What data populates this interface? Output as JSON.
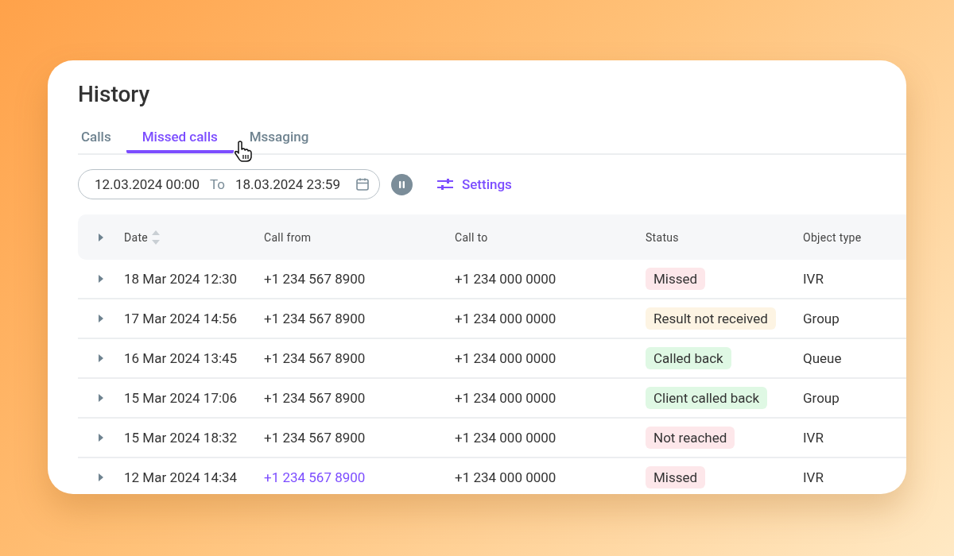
{
  "title": "History",
  "tabs": [
    {
      "label": "Calls",
      "selected": false
    },
    {
      "label": "Missed calls",
      "selected": true
    },
    {
      "label": "Mssaging",
      "selected": false
    }
  ],
  "filter": {
    "from": "12.03.2024 00:00",
    "separator": "To",
    "to": "18.03.2024 23:59",
    "settings": "Settings"
  },
  "table": {
    "columns": [
      "Date",
      "Call from",
      "Call to",
      "Status",
      "Object type"
    ],
    "rows": [
      {
        "date": "18 Mar 2024 12:30",
        "call_from": "+1 234 567 8900",
        "hovered": false,
        "call_to": "+1 234 000 0000",
        "status": "Missed",
        "color": "#fde7ea",
        "object_type": "IVR"
      },
      {
        "date": "17 Mar 2024 14:56",
        "call_from": "+1 234 567 8900",
        "hovered": false,
        "call_to": "+1 234 000 0000",
        "status": "Result not received",
        "color": "#fdf4e3",
        "object_type": "Group"
      },
      {
        "date": "16 Mar 2024 13:45",
        "call_from": "+1 234 567 8900",
        "hovered": false,
        "call_to": "+1 234 000 0000",
        "status": "Called back",
        "color": "#dff8e4",
        "object_type": "Queue"
      },
      {
        "date": "15 Mar 2024 17:06",
        "call_from": "+1 234 567 8900",
        "hovered": false,
        "call_to": "+1 234 000 0000",
        "status": "Client called back",
        "color": "#dff8e4",
        "object_type": "Group"
      },
      {
        "date": "15 Mar 2024 18:32",
        "call_from": "+1 234 567 8900",
        "hovered": false,
        "call_to": "+1 234 000 0000",
        "status": "Not reached",
        "color": "#fde7ea",
        "object_type": "IVR"
      },
      {
        "date": "12 Mar 2024 14:34",
        "call_from": "+1 234 567 8900",
        "hovered": true,
        "call_to": "+1 234 000 0000",
        "status": "Missed",
        "color": "#fde7ea",
        "object_type": "IVR"
      }
    ]
  }
}
